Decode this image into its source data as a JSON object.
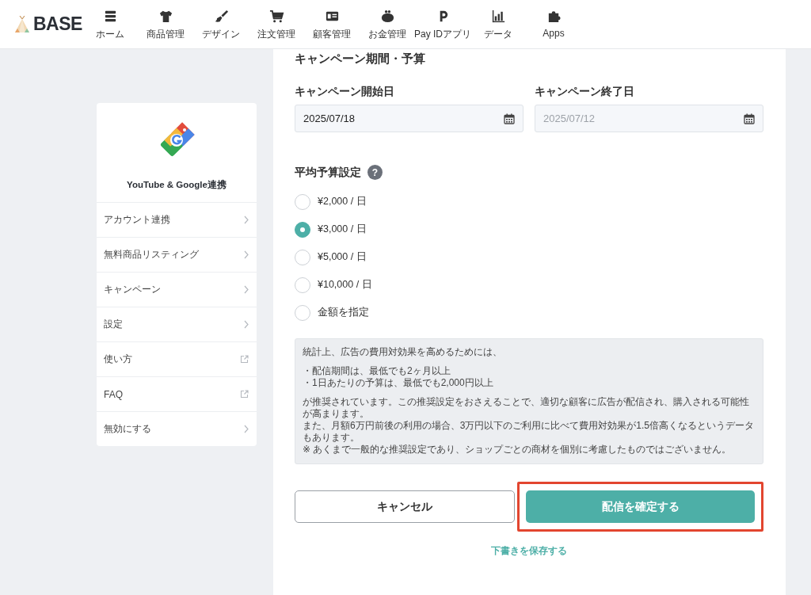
{
  "header": {
    "logo": "BASE",
    "nav": [
      {
        "label": "ホーム"
      },
      {
        "label": "商品管理"
      },
      {
        "label": "デザイン"
      },
      {
        "label": "注文管理"
      },
      {
        "label": "顧客管理"
      },
      {
        "label": "お金管理"
      },
      {
        "label": "Pay IDアプリ"
      },
      {
        "label": "データ"
      },
      {
        "label": "Apps"
      }
    ]
  },
  "sidebar": {
    "title": "YouTube & Google連携",
    "items": [
      {
        "label": "アカウント連携",
        "kind": "chevron"
      },
      {
        "label": "無料商品リスティング",
        "kind": "chevron"
      },
      {
        "label": "キャンペーン",
        "kind": "chevron"
      },
      {
        "label": "設定",
        "kind": "chevron"
      },
      {
        "label": "使い方",
        "kind": "external"
      },
      {
        "label": "FAQ",
        "kind": "external"
      },
      {
        "label": "無効にする",
        "kind": "chevron"
      }
    ]
  },
  "form": {
    "section_title": "キャンペーン期間・予算",
    "start": {
      "label": "キャンペーン開始日",
      "value": "2025/07/18"
    },
    "end": {
      "label": "キャンペーン終了日",
      "placeholder": "2025/07/12"
    },
    "budget": {
      "label": "平均予算設定",
      "help": "?",
      "options": [
        {
          "label": "¥2,000 / 日",
          "selected": false
        },
        {
          "label": "¥3,000 / 日",
          "selected": true
        },
        {
          "label": "¥5,000 / 日",
          "selected": false
        },
        {
          "label": "¥10,000 / 日",
          "selected": false
        },
        {
          "label": "金額を指定",
          "selected": false
        }
      ]
    },
    "notice": {
      "intro": "統計上、広告の費用対効果を高めるためには、",
      "bullets": [
        "・配信期間は、最低でも2ヶ月以上",
        "・1日あたりの予算は、最低でも2,000円以上"
      ],
      "body": [
        "が推奨されています。この推奨設定をおさえることで、適切な顧客に広告が配信され、購入される可能性が高まります。",
        "また、月額6万円前後の利用の場合、3万円以下のご利用に比べて費用対効果が1.5倍高くなるというデータもあります。",
        "※ あくまで一般的な推奨設定であり、ショップごとの商材を個別に考慮したものではございません。"
      ]
    },
    "cancel": "キャンセル",
    "confirm": {
      "label": "配信を確定する",
      "highlighted": true
    },
    "draft": "下書きを保存する"
  }
}
